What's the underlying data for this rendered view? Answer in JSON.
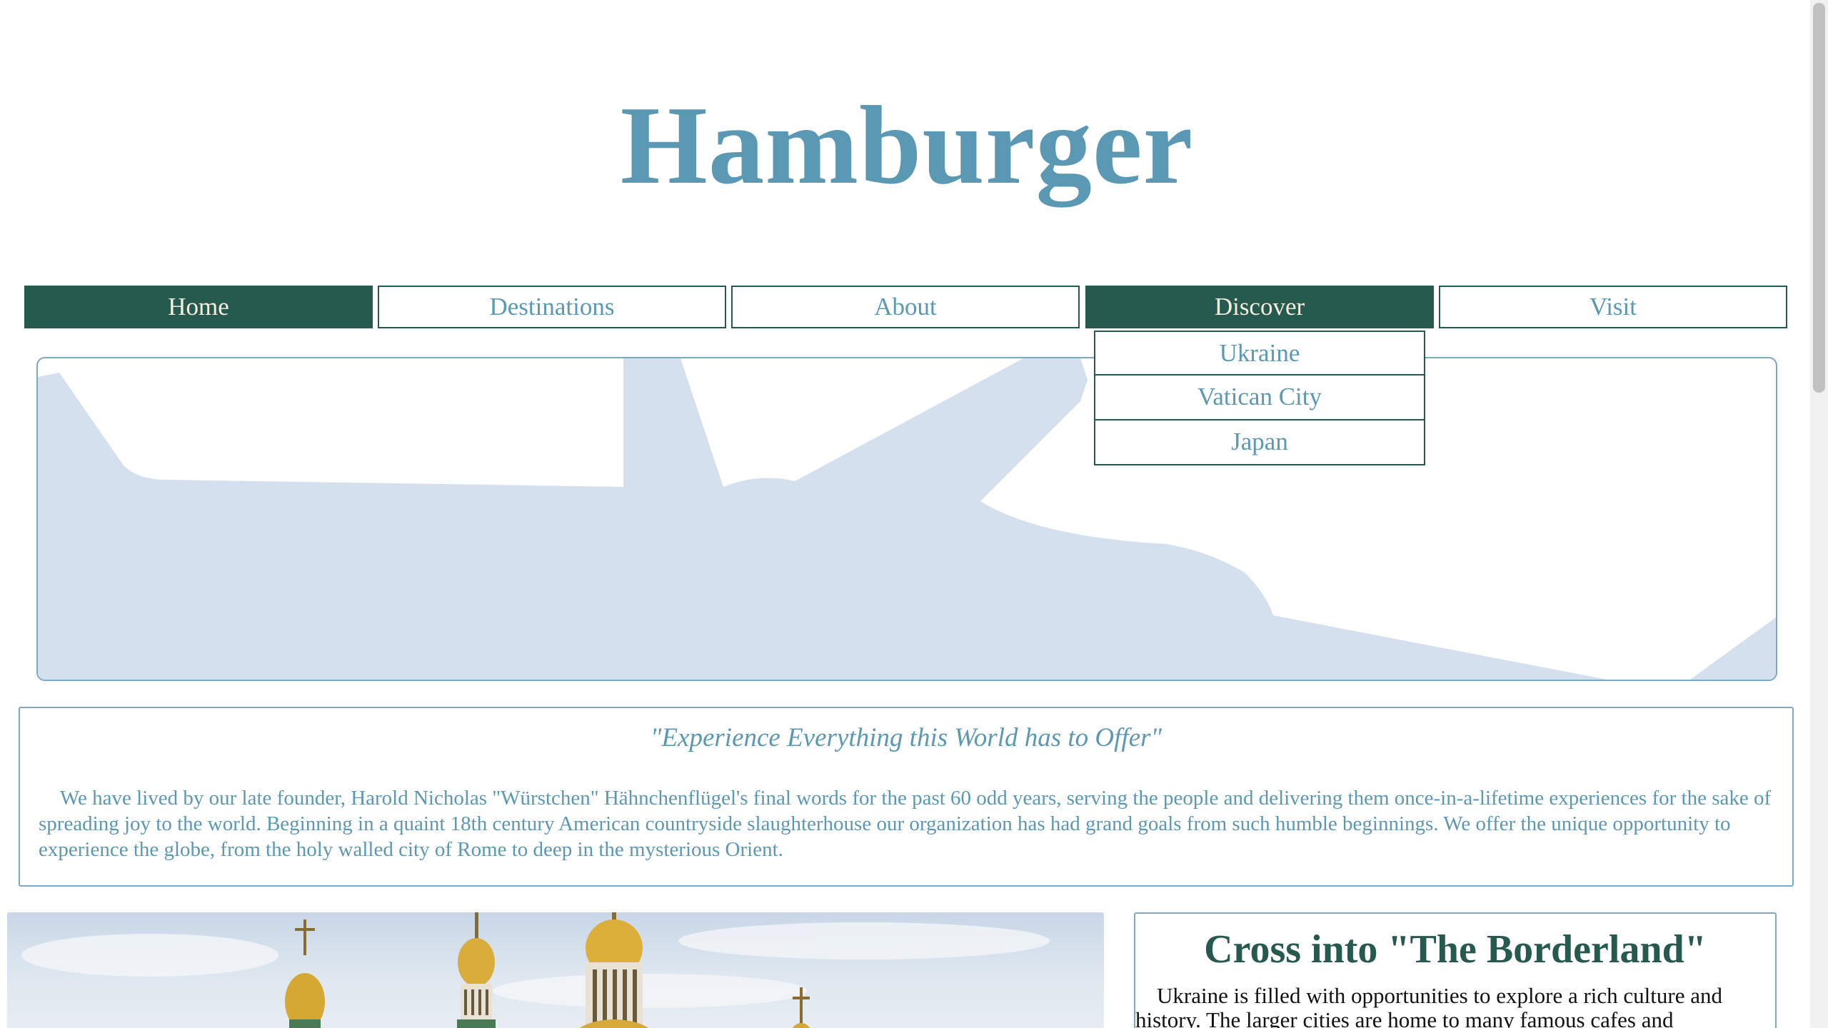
{
  "site": {
    "title": "Hamburger"
  },
  "nav": {
    "items": [
      {
        "label": "Home",
        "active": true
      },
      {
        "label": "Destinations",
        "active": false
      },
      {
        "label": "About",
        "active": false
      },
      {
        "label": "Discover",
        "active": true
      },
      {
        "label": "Visit",
        "active": false
      }
    ],
    "dropdown": [
      "Ukraine",
      "Vatican City",
      "Japan"
    ]
  },
  "intro": {
    "tagline": "\"Experience Everything this World has to Offer\"",
    "text": "We have lived by our late founder, Harold Nicholas \"Würstchen\" Hähnchenflügel's final words for the past 60 odd years, serving the people and delivering them once-in-a-lifetime experiences for the sake of spreading joy to the world. Beginning in a quaint 18th century American countryside slaughterhouse our organization has had grand goals from such humble beginnings. We offer the unique opportunity to experience the globe, from the holy walled city of Rome to deep in the mysterious Orient."
  },
  "feature": {
    "title": "Cross into \"The Borderland\"",
    "text": "Ukraine is filled with opportunities to explore a rich culture and history. The larger cities are home to many famous cafes and"
  },
  "colors": {
    "brand_blue": "#5a98b4",
    "dark_green": "#275a4f",
    "cream": "#f6eede",
    "plane_silhouette": "#d5e0ef"
  },
  "icons": {
    "banner": "airplane-silhouette",
    "photo": "cathedral-domes"
  }
}
